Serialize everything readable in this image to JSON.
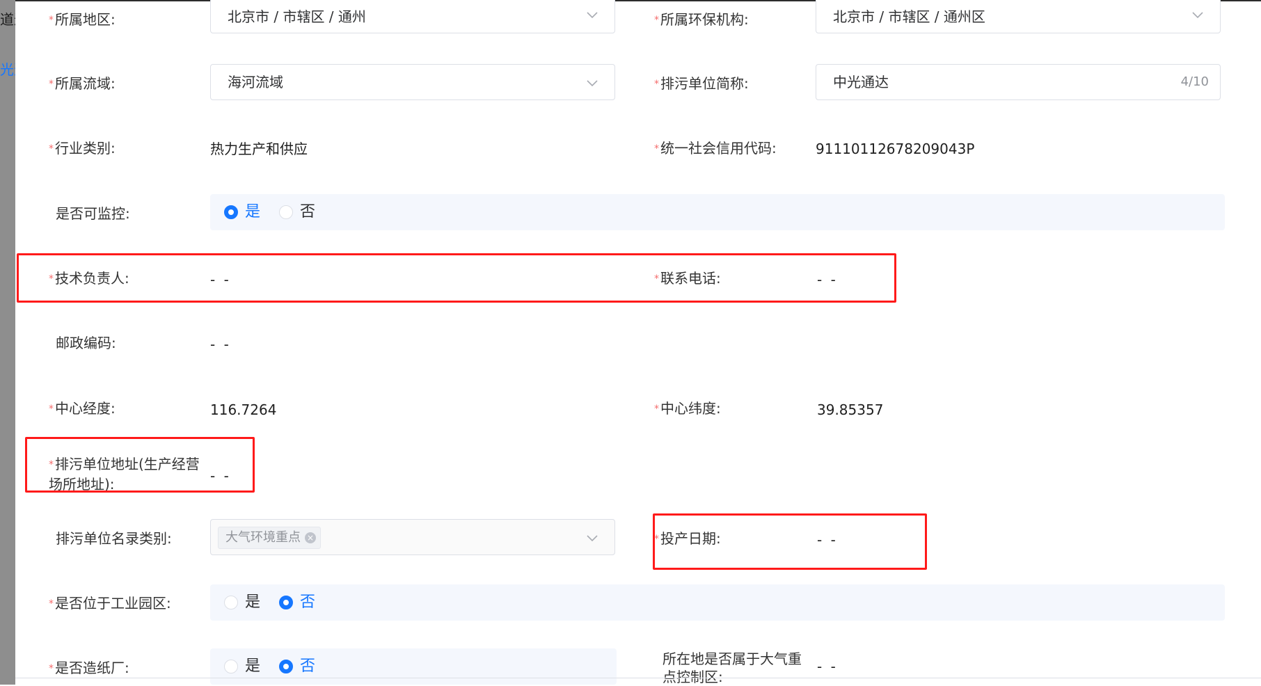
{
  "backdrop": {
    "text_1": "道达",
    "text_2": "光道"
  },
  "form": {
    "region": {
      "label": "所属地区:",
      "value": "北京市 / 市辖区 / 通州"
    },
    "env_agency": {
      "label": "所属环保机构:",
      "value": "北京市 / 市辖区 / 通州区"
    },
    "basin": {
      "label": "所属流域:",
      "value": "海河流域"
    },
    "short_name": {
      "label": "排污单位简称:",
      "value": "中光通达",
      "count": "4/10"
    },
    "industry": {
      "label": "行业类别:",
      "value": "热力生产和供应"
    },
    "credit_code": {
      "label": "统一社会信用代码:",
      "value": "91110112678209043P"
    },
    "monitorable": {
      "label": "是否可监控:",
      "options": [
        "是",
        "否"
      ],
      "selected": "是"
    },
    "tech_lead": {
      "label": "技术负责人:",
      "value": "- -"
    },
    "phone": {
      "label": "联系电话:",
      "value": "- -"
    },
    "postcode": {
      "label": "邮政编码:",
      "value": "- -"
    },
    "longitude": {
      "label": "中心经度:",
      "value": "116.7264"
    },
    "latitude": {
      "label": "中心纬度:",
      "value": "39.85357"
    },
    "address": {
      "label": "排污单位地址(生产经营场所地址):",
      "value": "- -"
    },
    "directory_type": {
      "label": "排污单位名录类别:",
      "tag": "大气环境重点",
      "tag_close": "×"
    },
    "production_date": {
      "label": "投产日期:",
      "value": "- -"
    },
    "industrial_park": {
      "label": "是否位于工业园区:",
      "options": [
        "是",
        "否"
      ],
      "selected": "否"
    },
    "paper_mill": {
      "label": "是否造纸厂:",
      "options": [
        "是",
        "否"
      ],
      "selected": "否"
    },
    "air_control_zone": {
      "label": "所在地是否属于大气重点控制区:",
      "value": "- -"
    }
  },
  "colors": {
    "primary": "#1677ff",
    "required": "#f56c6c",
    "highlight_box": "#ff1a1a",
    "radio_bg": "#f4f7fd"
  }
}
